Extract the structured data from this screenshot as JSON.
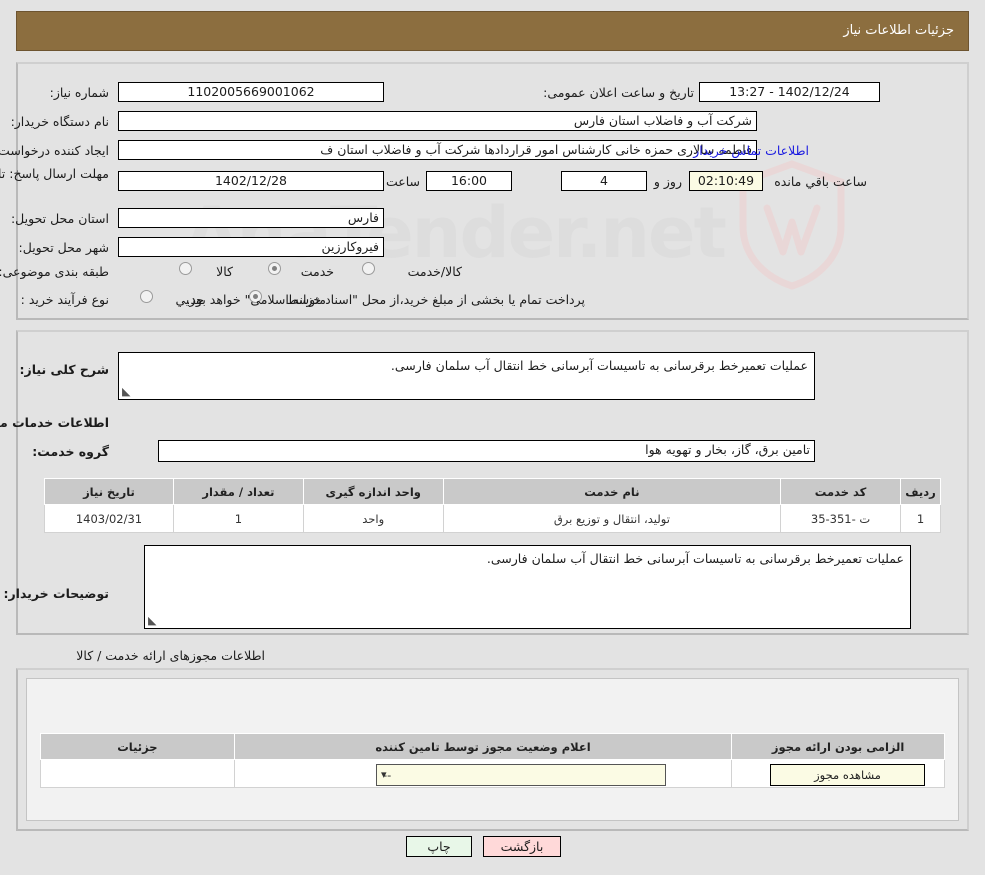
{
  "header": {
    "title": "جزئیات اطلاعات نیاز"
  },
  "watermark": {
    "text": "AnaTender.net"
  },
  "top_form": {
    "need_number_label": "شماره نیاز:",
    "need_number_value": "1102005669001062",
    "announce_label": "تاریخ و ساعت اعلان عمومی:",
    "announce_value": "1402/12/24 - 13:27",
    "buyer_org_label": "نام دستگاه خریدار:",
    "buyer_org_value": "شرکت آب و فاضلاب استان فارس",
    "creator_label": "ایجاد کننده درخواست:",
    "creator_value": "فاطمه سالاری حمزه خانی کارشناس امور قراردادها شرکت آب و فاضلاب استان ف",
    "contact_link": "اطلاعات تماس خریدار",
    "deadline_label": "مهلت ارسال پاسخ: تا تاریخ:",
    "deadline_date": "1402/12/28",
    "hour_label": "ساعت",
    "hour_value": "16:00",
    "days_value": "4",
    "days_label": "روز و",
    "countdown_value": "02:10:49",
    "countdown_label": "ساعت باقي مانده",
    "province_label": "استان محل تحویل:",
    "province_value": "فارس",
    "city_label": "شهر محل تحویل:",
    "city_value": "فیروکارزین",
    "category_label": "طبقه بندی موضوعی:",
    "category_options": [
      "کالا",
      "خدمت",
      "کالا/خدمت"
    ],
    "category_selected": "خدمت",
    "process_label": "نوع فرآیند خرید :",
    "process_options": [
      "جزیي",
      "متوسط"
    ],
    "process_selected": "متوسط",
    "treasury_note": "پرداخت تمام یا بخشی از مبلغ خرید،از محل \"اسناد خزانه اسلامی\" خواهد بود."
  },
  "mid_section": {
    "need_desc_label": "شرح کلی نیاز:",
    "need_desc_value": "عملیات تعمیرخط برقرسانی به تاسیسات آبرسانی خط انتقال آب سلمان فارسی.",
    "services_info_title": "اطلاعات خدمات مورد نیاز",
    "service_group_label": "گروه خدمت:",
    "service_group_value": "تامین برق، گاز، بخار و تهویه هوا",
    "table": {
      "columns": [
        "ردیف",
        "کد خدمت",
        "نام خدمت",
        "واحد اندازه گیری",
        "تعداد / مقدار",
        "تاریخ نیاز"
      ],
      "rows": [
        [
          "1",
          "ت -351-35",
          "تولید، انتقال و توزیع برق",
          "واحد",
          "1",
          "1403/02/31"
        ]
      ]
    },
    "buyer_notes_label": "توضیحات خریدار:",
    "buyer_notes_value": "عملیات تعمیرخط برقرسانی به تاسیسات آبرسانی خط انتقال آب سلمان فارسی."
  },
  "permits": {
    "section_title": "اطلاعات مجوزهای ارائه خدمت / کالا",
    "columns": [
      "الزامی بودن ارائه مجوز",
      "اعلام وضعیت مجوز توسط تامین کننده",
      "جزئیات"
    ],
    "row": {
      "required_checked": true,
      "status_value": "--",
      "details_button": "مشاهده مجوز"
    }
  },
  "footer": {
    "print_label": "چاپ",
    "back_label": "بازگشت"
  },
  "colors": {
    "header_bar": "#8c6e3f",
    "link": "#1a1ae0",
    "print_button": "#e8f7e8",
    "back_button": "#ffd9d9",
    "field_highlight": "#fbfbe4"
  }
}
